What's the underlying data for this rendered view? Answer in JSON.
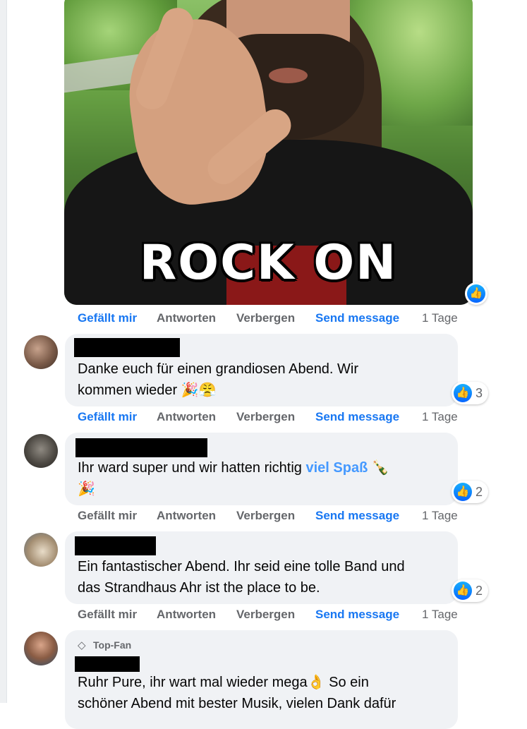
{
  "gif": {
    "caption": "ROCK ON"
  },
  "labels": {
    "like": "Gefällt mir",
    "reply": "Antworten",
    "hide": "Verbergen",
    "send": "Send message"
  },
  "post_actions": {
    "time": "1 Tage"
  },
  "comments": [
    {
      "line1": "Danke euch für einen grandiosen Abend. Wir",
      "line2": "kommen wieder 🎉😤",
      "reactions": "3",
      "time": "1 Tage"
    },
    {
      "line1_pre": "Ihr ward super und wir hatten richtig ",
      "line1_highlight": "viel Spaß",
      "line1_post": " 🍾",
      "line2": "🎉",
      "reactions": "2",
      "time": "1 Tage"
    },
    {
      "line1": "Ein fantastischer Abend. Ihr seid eine tolle Band und",
      "line2": "das Strandhaus Ahr ist the place to be.",
      "reactions": "2",
      "time": "1 Tage"
    },
    {
      "badge": "Top-Fan",
      "line1": "Ruhr Pure, ihr wart mal wieder mega👌 So ein",
      "line2": "schöner Abend mit bester Musik, vielen Dank dafür"
    }
  ],
  "colors": {
    "link_blue": "#1877f2",
    "bubble": "#f0f2f5",
    "muted": "#65676b"
  }
}
